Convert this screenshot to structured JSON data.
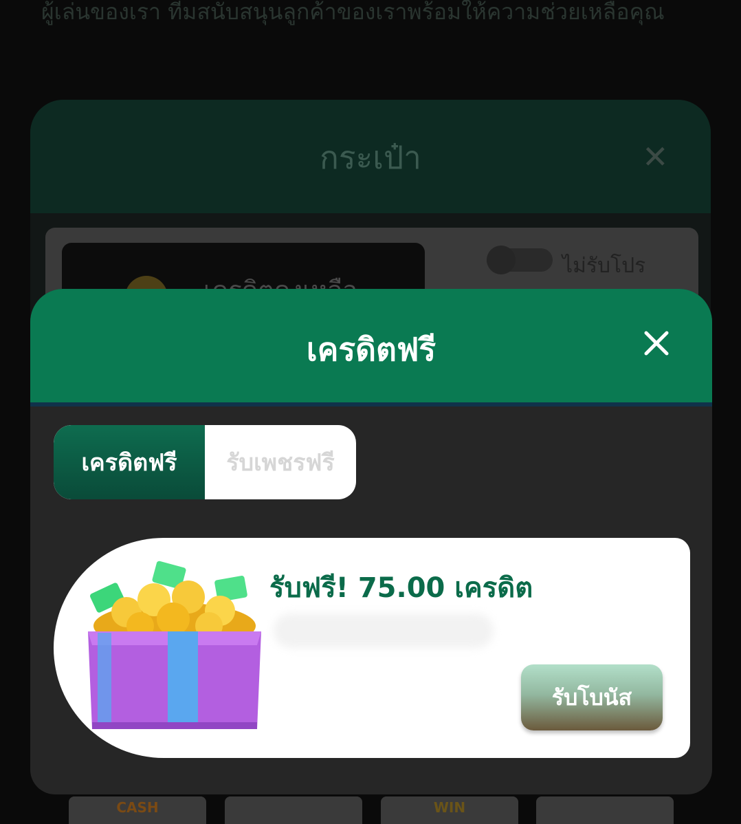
{
  "background": {
    "top_text": "ผู้เล่นของเรา ทีมสนับสนุนลูกค้าของเราพร้อมให้ความช่วยเหลือคุณ",
    "wallet": {
      "title": "กระเป๋า",
      "close_icon": "close-icon",
      "credit_label": "เครดิตคงเหลือ",
      "promo_toggle_label": "ไม่รับโปร",
      "promo_toggle_on": false
    },
    "tiles": [
      {
        "label": "CASH",
        "color": "#7a4a14"
      },
      {
        "label": "",
        "color": "#2c4b78"
      },
      {
        "label": "WIN",
        "color": "#6a5418"
      },
      {
        "label": "",
        "color": "#3a3a78"
      }
    ]
  },
  "modal": {
    "title": "เครดิตฟรี",
    "close_icon": "close-icon",
    "tabs": [
      {
        "label": "เครดิตฟรี",
        "active": true
      },
      {
        "label": "รับเพชรฟรี",
        "active": false
      }
    ],
    "bonus": {
      "icon": "gift-box-icon",
      "text": "รับฟรี! 75.00 เครดิต",
      "button_label": "รับโบนัส"
    }
  },
  "colors": {
    "header_green": "#0a7a52",
    "text_green": "#0b6b4a",
    "modal_bg": "#262626"
  }
}
